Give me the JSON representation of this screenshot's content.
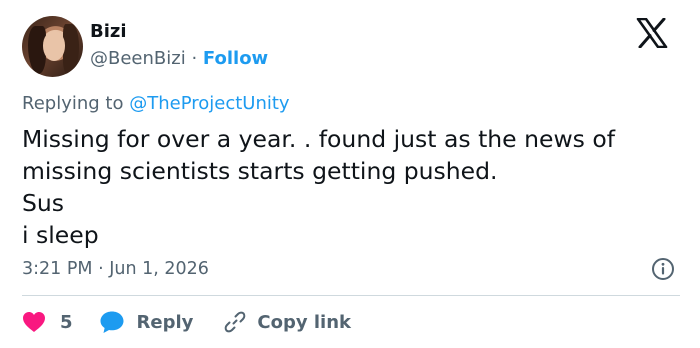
{
  "author": {
    "name": "Bizi",
    "handle": "@BeenBizi",
    "separator": "·",
    "follow_label": "Follow"
  },
  "reply_context": {
    "prefix": "Replying to",
    "mention": "@TheProjectUnity"
  },
  "tweet": {
    "text": "Missing for over a year. . found just as the news of\nmissing scientists starts getting pushed.\nSus\ni sleep",
    "timestamp": "3:21 PM · Jun 1, 2026"
  },
  "actions": {
    "like_count": "5",
    "reply_label": "Reply",
    "copy_link_label": "Copy link"
  },
  "colors": {
    "accent": "#1d9bf0",
    "like": "#f91880",
    "secondary_text": "#536471",
    "divider": "#cfd9de"
  },
  "icons": [
    "x-logo-icon",
    "info-icon",
    "heart-icon",
    "reply-bubble-icon",
    "link-icon"
  ]
}
